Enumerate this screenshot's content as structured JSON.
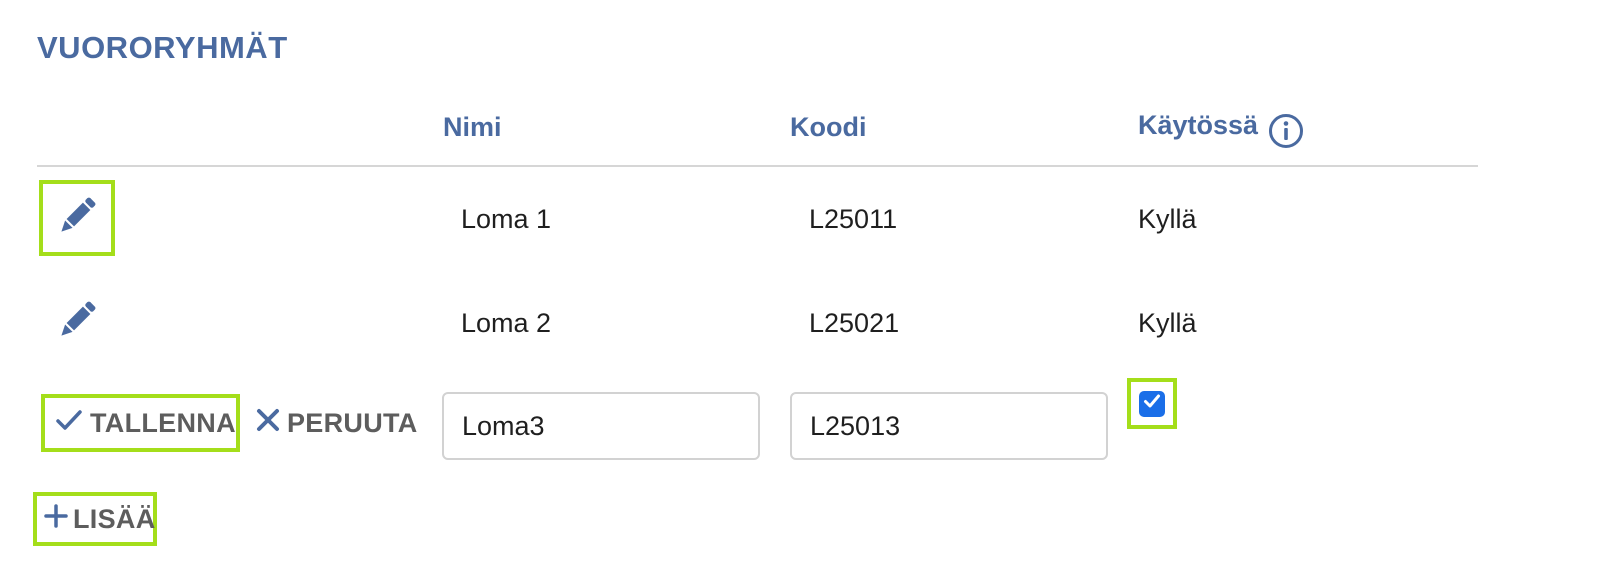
{
  "section": {
    "title": "VUORORYHMÄT"
  },
  "table": {
    "headers": {
      "name": "Nimi",
      "code": "Koodi",
      "active": "Käytössä"
    },
    "rows": [
      {
        "name": "Loma 1",
        "code": "L25011",
        "active": "Kyllä"
      },
      {
        "name": "Loma 2",
        "code": "L25021",
        "active": "Kyllä"
      }
    ]
  },
  "edit_row": {
    "save_label": "TALLENNA",
    "cancel_label": "PERUUTA",
    "name_value": "Loma3",
    "code_value": "L25013",
    "active_checked": true
  },
  "add_label": "LISÄÄ",
  "icons": {
    "edit": "pencil-icon",
    "info": "info-icon",
    "save": "check-icon",
    "cancel": "close-icon",
    "add": "plus-icon",
    "checkbox": "checkmark-icon"
  },
  "colors": {
    "accent": "#4a6aa0",
    "highlight": "#a4de1a",
    "checkbox": "#1a6ee8",
    "button_text": "#5d5d5d"
  }
}
